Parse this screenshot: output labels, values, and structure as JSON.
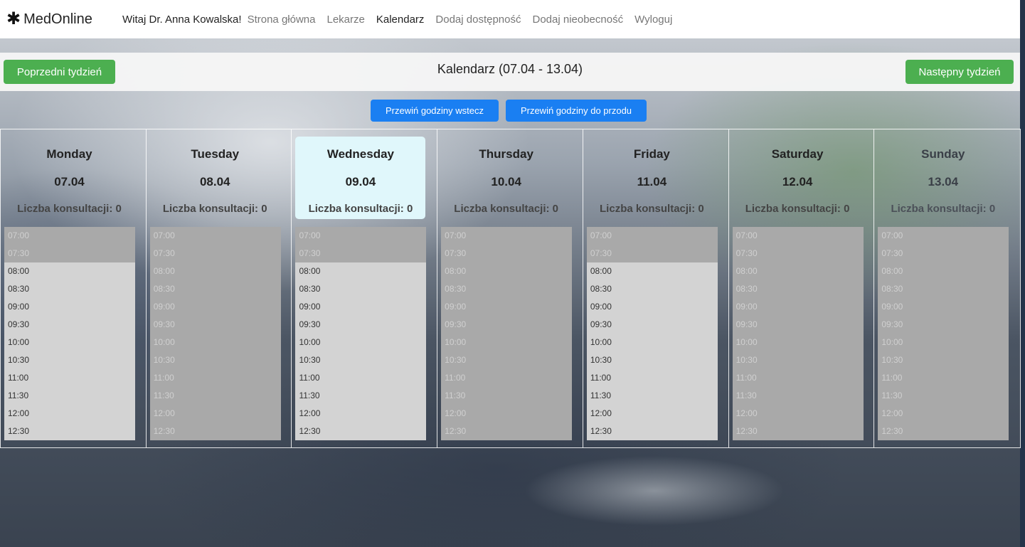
{
  "nav": {
    "brand": "MedOnline",
    "brand_icon": "asterisk-icon",
    "welcome": "Witaj Dr. Anna Kowalska!",
    "links": [
      "Strona główna",
      "Lekarze",
      "Kalendarz",
      "Dodaj dostępność",
      "Dodaj nieobecność",
      "Wyloguj"
    ],
    "active_link": "Kalendarz"
  },
  "week": {
    "title": "Kalendarz (07.04 - 13.04)",
    "prev_label": "Poprzedni tydzień",
    "next_label": "Następny tydzień"
  },
  "scroll": {
    "back_label": "Przewiń godziny wstecz",
    "forward_label": "Przewiń godziny do przodu"
  },
  "days": [
    {
      "name": "Monday",
      "date": "07.04",
      "count": "Liczba konsultacji: 0",
      "today": false,
      "slots": [
        {
          "t": "07:00",
          "a": false
        },
        {
          "t": "07:30",
          "a": false
        },
        {
          "t": "08:00",
          "a": true
        },
        {
          "t": "08:30",
          "a": true
        },
        {
          "t": "09:00",
          "a": true
        },
        {
          "t": "09:30",
          "a": true
        },
        {
          "t": "10:00",
          "a": true
        },
        {
          "t": "10:30",
          "a": true
        },
        {
          "t": "11:00",
          "a": true
        },
        {
          "t": "11:30",
          "a": true
        },
        {
          "t": "12:00",
          "a": true
        },
        {
          "t": "12:30",
          "a": true
        }
      ]
    },
    {
      "name": "Tuesday",
      "date": "08.04",
      "count": "Liczba konsultacji: 0",
      "today": false,
      "slots": [
        {
          "t": "07:00",
          "a": false
        },
        {
          "t": "07:30",
          "a": false
        },
        {
          "t": "08:00",
          "a": false
        },
        {
          "t": "08:30",
          "a": false
        },
        {
          "t": "09:00",
          "a": false
        },
        {
          "t": "09:30",
          "a": false
        },
        {
          "t": "10:00",
          "a": false
        },
        {
          "t": "10:30",
          "a": false
        },
        {
          "t": "11:00",
          "a": false
        },
        {
          "t": "11:30",
          "a": false
        },
        {
          "t": "12:00",
          "a": false
        },
        {
          "t": "12:30",
          "a": false
        }
      ]
    },
    {
      "name": "Wednesday",
      "date": "09.04",
      "count": "Liczba konsultacji: 0",
      "today": true,
      "slots": [
        {
          "t": "07:00",
          "a": false
        },
        {
          "t": "07:30",
          "a": false
        },
        {
          "t": "08:00",
          "a": true
        },
        {
          "t": "08:30",
          "a": true
        },
        {
          "t": "09:00",
          "a": true
        },
        {
          "t": "09:30",
          "a": true
        },
        {
          "t": "10:00",
          "a": true
        },
        {
          "t": "10:30",
          "a": true
        },
        {
          "t": "11:00",
          "a": true
        },
        {
          "t": "11:30",
          "a": true
        },
        {
          "t": "12:00",
          "a": true
        },
        {
          "t": "12:30",
          "a": true
        }
      ]
    },
    {
      "name": "Thursday",
      "date": "10.04",
      "count": "Liczba konsultacji: 0",
      "today": false,
      "slots": [
        {
          "t": "07:00",
          "a": false
        },
        {
          "t": "07:30",
          "a": false
        },
        {
          "t": "08:00",
          "a": false
        },
        {
          "t": "08:30",
          "a": false
        },
        {
          "t": "09:00",
          "a": false
        },
        {
          "t": "09:30",
          "a": false
        },
        {
          "t": "10:00",
          "a": false
        },
        {
          "t": "10:30",
          "a": false
        },
        {
          "t": "11:00",
          "a": false
        },
        {
          "t": "11:30",
          "a": false
        },
        {
          "t": "12:00",
          "a": false
        },
        {
          "t": "12:30",
          "a": false
        }
      ]
    },
    {
      "name": "Friday",
      "date": "11.04",
      "count": "Liczba konsultacji: 0",
      "today": false,
      "slots": [
        {
          "t": "07:00",
          "a": false
        },
        {
          "t": "07:30",
          "a": false
        },
        {
          "t": "08:00",
          "a": true
        },
        {
          "t": "08:30",
          "a": true
        },
        {
          "t": "09:00",
          "a": true
        },
        {
          "t": "09:30",
          "a": true
        },
        {
          "t": "10:00",
          "a": true
        },
        {
          "t": "10:30",
          "a": true
        },
        {
          "t": "11:00",
          "a": true
        },
        {
          "t": "11:30",
          "a": true
        },
        {
          "t": "12:00",
          "a": true
        },
        {
          "t": "12:30",
          "a": true
        }
      ]
    },
    {
      "name": "Saturday",
      "date": "12.04",
      "count": "Liczba konsultacji: 0",
      "today": false,
      "slots": [
        {
          "t": "07:00",
          "a": false
        },
        {
          "t": "07:30",
          "a": false
        },
        {
          "t": "08:00",
          "a": false
        },
        {
          "t": "08:30",
          "a": false
        },
        {
          "t": "09:00",
          "a": false
        },
        {
          "t": "09:30",
          "a": false
        },
        {
          "t": "10:00",
          "a": false
        },
        {
          "t": "10:30",
          "a": false
        },
        {
          "t": "11:00",
          "a": false
        },
        {
          "t": "11:30",
          "a": false
        },
        {
          "t": "12:00",
          "a": false
        },
        {
          "t": "12:30",
          "a": false
        }
      ]
    },
    {
      "name": "Sunday",
      "date": "13.04",
      "count": "Liczba konsultacji: 0",
      "today": false,
      "slots": [
        {
          "t": "07:00",
          "a": false
        },
        {
          "t": "07:30",
          "a": false
        },
        {
          "t": "08:00",
          "a": false
        },
        {
          "t": "08:30",
          "a": false
        },
        {
          "t": "09:00",
          "a": false
        },
        {
          "t": "09:30",
          "a": false
        },
        {
          "t": "10:00",
          "a": false
        },
        {
          "t": "10:30",
          "a": false
        },
        {
          "t": "11:00",
          "a": false
        },
        {
          "t": "11:30",
          "a": false
        },
        {
          "t": "12:00",
          "a": false
        },
        {
          "t": "12:30",
          "a": false
        }
      ]
    }
  ],
  "colors": {
    "primary_green": "#4caf50",
    "primary_blue": "#1a7ff2",
    "today_highlight": "#e0f7fb",
    "slot_available": "#d3d3d3",
    "slot_unavailable": "#a9a9a9"
  }
}
